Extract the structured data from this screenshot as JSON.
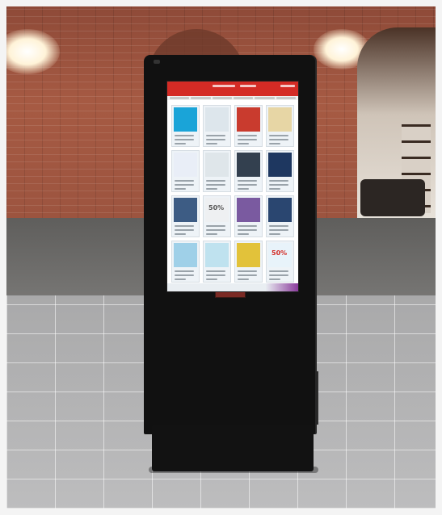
{
  "scene": {
    "subject": "",
    "setting": ""
  },
  "kiosk_screen": {
    "brand": "",
    "tiles": [
      {
        "color": "#1aa4d8",
        "pct": ""
      },
      {
        "color": "#dde6ec",
        "pct": ""
      },
      {
        "color": "#c93b2e",
        "pct": ""
      },
      {
        "color": "#e7d6a5",
        "pct": ""
      },
      {
        "color": "#e9eef7",
        "pct": ""
      },
      {
        "color": "#dfe6ea",
        "pct": ""
      },
      {
        "color": "#33404f",
        "pct": ""
      },
      {
        "color": "#1e3760",
        "pct": ""
      },
      {
        "color": "#3d5c84",
        "pct": ""
      },
      {
        "color": "#eef0f2",
        "pct": "50%"
      },
      {
        "color": "#7a5aa0",
        "pct": ""
      },
      {
        "color": "#2a4670",
        "pct": ""
      },
      {
        "color": "#9fd0e8",
        "pct": ""
      },
      {
        "color": "#bfe2ef",
        "pct": ""
      },
      {
        "color": "#e2c23a",
        "pct": ""
      },
      {
        "color": "#e8f3fa",
        "pct": "50%"
      }
    ]
  }
}
